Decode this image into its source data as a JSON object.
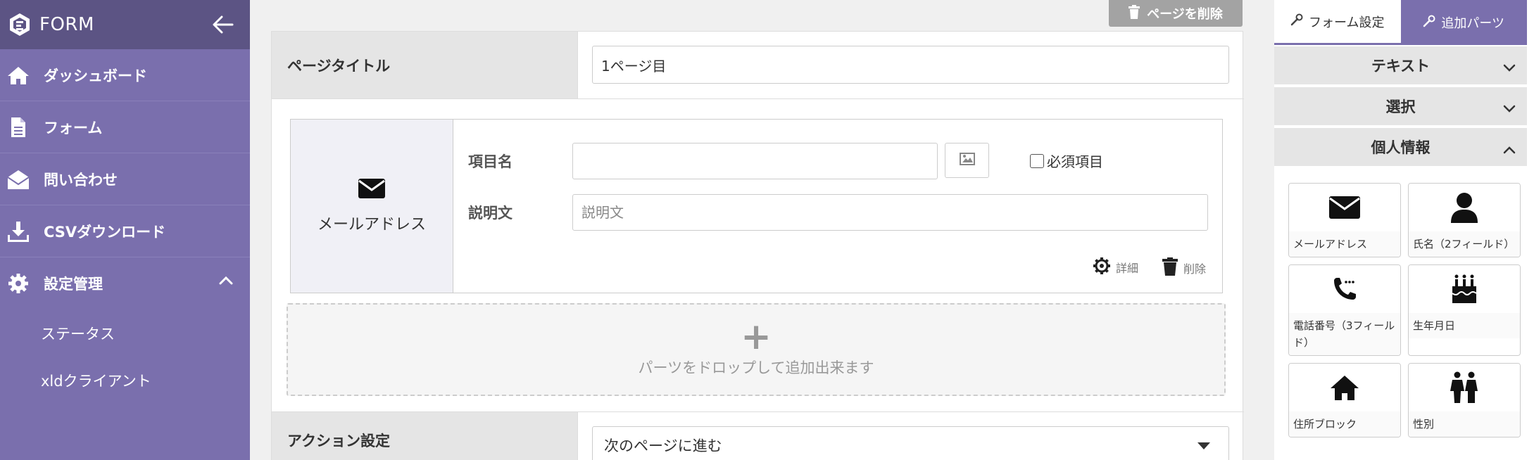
{
  "sidebar": {
    "brand": "FORM",
    "nav": [
      {
        "label": "ダッシュボード"
      },
      {
        "label": "フォーム"
      },
      {
        "label": "問い合わせ"
      },
      {
        "label": "CSVダウンロード"
      },
      {
        "label": "設定管理"
      }
    ],
    "subnav": [
      {
        "label": "ステータス"
      },
      {
        "label": "xldクライアント"
      }
    ]
  },
  "main": {
    "delete_page_label": "ページを削除",
    "page_title_label": "ページタイトル",
    "page_title_value": "1ページ目",
    "part": {
      "type_label": "メールアドレス",
      "item_name_label": "項目名",
      "item_name_value": "",
      "description_label": "説明文",
      "description_placeholder": "説明文",
      "required_label": "必須項目",
      "detail_label": "詳細",
      "delete_label": "削除"
    },
    "drop_zone_text": "パーツをドロップして追加出来ます",
    "action_label": "アクション設定",
    "action_value": "次のページに進む"
  },
  "right_panel": {
    "tabs": [
      {
        "label": "フォーム設定"
      },
      {
        "label": "追加パーツ"
      }
    ],
    "accordions": [
      {
        "label": "テキスト"
      },
      {
        "label": "選択"
      },
      {
        "label": "個人情報"
      }
    ],
    "parts": [
      {
        "label": "メールアドレス",
        "icon": "envelope-icon"
      },
      {
        "label": "氏名（2フィールド）",
        "icon": "person-icon"
      },
      {
        "label": "電話番号（3フィールド）",
        "icon": "phone-icon"
      },
      {
        "label": "生年月日",
        "icon": "cake-icon"
      },
      {
        "label": "住所ブロック",
        "icon": "home-icon"
      },
      {
        "label": "性別",
        "icon": "gender-icon"
      }
    ]
  },
  "colors": {
    "sidebar_bg": "#7a6fad",
    "sidebar_header_bg": "#5c5484",
    "active_tab_bg": "#7a6fad",
    "delete_button_bg": "#a3a3a3"
  }
}
